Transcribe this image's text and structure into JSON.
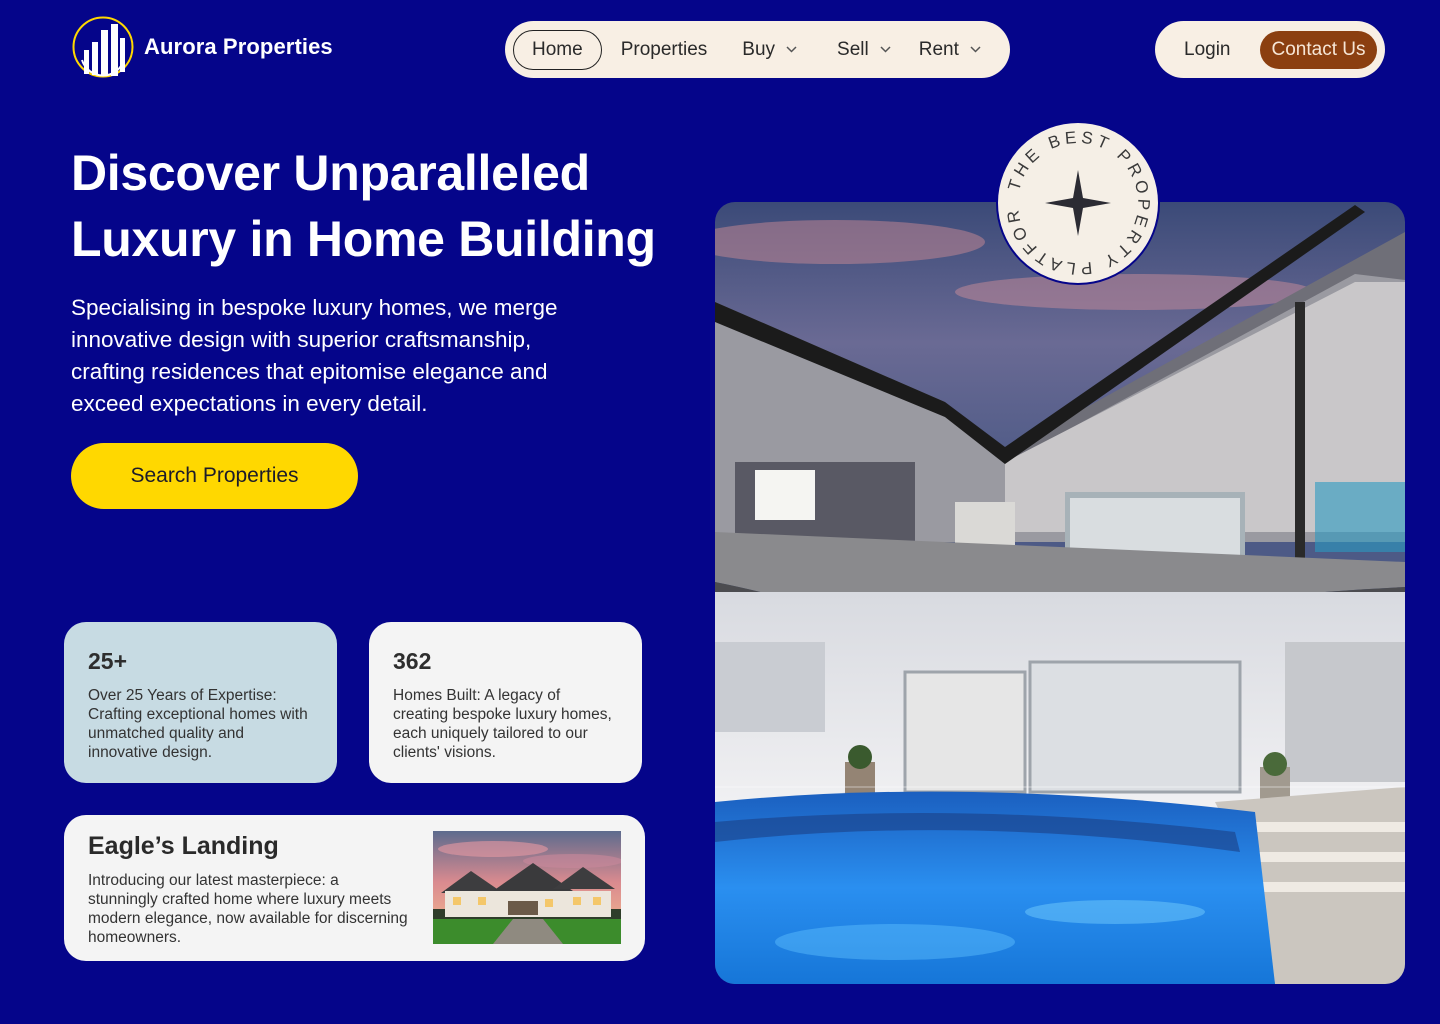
{
  "brand": {
    "name": "Aurora Properties",
    "logo_icon": "building-icon"
  },
  "nav": {
    "items": [
      {
        "label": "Home",
        "active": true
      },
      {
        "label": "Properties"
      },
      {
        "label": "Buy",
        "dropdown": true
      },
      {
        "label": "Sell",
        "dropdown": true
      },
      {
        "label": "Rent",
        "dropdown": true
      }
    ],
    "login": "Login",
    "contact": "Contact Us"
  },
  "hero": {
    "title_line1": "Discover Unparalleled",
    "title_line2": "Luxury in Home Building",
    "subtitle": "Specialising in bespoke luxury homes, we merge innovative design with superior craftsmanship, crafting residences that epitomise elegance and exceed expectations in every detail.",
    "cta": "Search Properties"
  },
  "stats": [
    {
      "number": "25+",
      "text": "Over 25 Years of Expertise: Crafting exceptional homes with unmatched quality and innovative design."
    },
    {
      "number": "362",
      "text": "Homes Built: A legacy of creating bespoke luxury homes, each uniquely tailored to our clients' visions."
    }
  ],
  "feature": {
    "title": "Eagle’s Landing",
    "text": "Introducing our latest masterpiece: a stunningly crafted home where luxury meets modern elegance, now available for discerning homeowners."
  },
  "badge": {
    "text": "THE BEST PROPERTY PLATFORM"
  },
  "colors": {
    "background": "#05058a",
    "pill": "#f8efe4",
    "cta": "#ffd800",
    "contact": "#8b3f10",
    "card_blue": "#c7dbe3",
    "card_light": "#f4f4f4"
  }
}
